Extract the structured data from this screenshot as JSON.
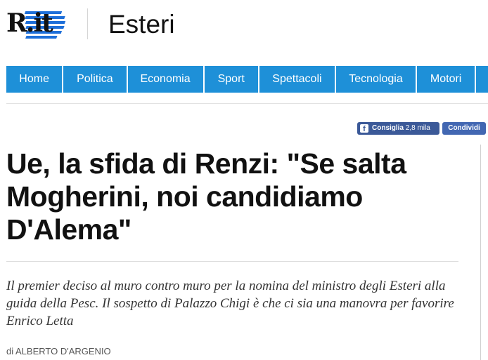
{
  "header": {
    "logo_text": "R.it",
    "section_title": "Esteri"
  },
  "nav": {
    "items": [
      {
        "label": "Home"
      },
      {
        "label": "Politica"
      },
      {
        "label": "Economia"
      },
      {
        "label": "Sport"
      },
      {
        "label": "Spettacoli"
      },
      {
        "label": "Tecnologia"
      },
      {
        "label": "Motori"
      }
    ]
  },
  "social": {
    "facebook_label": "Consiglia",
    "facebook_count": "2,8 mila",
    "share_label": "Condividi"
  },
  "article": {
    "headline": "Ue, la sfida di Renzi: \"Se salta Mogherini, noi candidiamo D'Alema\"",
    "summary": "Il premier deciso al muro contro muro per la nomina del ministro degli Esteri alla guida della Pesc. Il sospetto di Palazzo Chigi è che ci sia una manovra per favorire Enrico Letta",
    "byline": "di ALBERTO D'ARGENIO"
  },
  "colors": {
    "nav_background": "#1e90d8",
    "facebook": "#3b5998",
    "share": "#4267b2",
    "logo_accent": "#1e6fd9"
  },
  "icons": {
    "facebook": "facebook-icon"
  }
}
